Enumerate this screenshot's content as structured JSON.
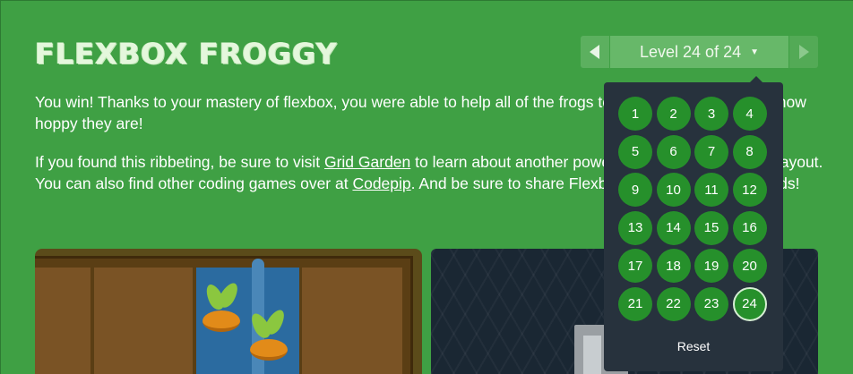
{
  "app": {
    "title": "FLEXBOX FROGGY"
  },
  "instructions": {
    "p1": "You win! Thanks to your mastery of flexbox, you were able to help all of the frogs to their lilypads. Just look how hoppy they are!",
    "p2_before": "If you found this ribbeting, be sure to visit ",
    "p2_link1": "Grid Garden",
    "p2_middle": " to learn about another powerful new feature of CSS layout. You can also find other coding games over at ",
    "p2_link2": "Codepip",
    "p2_after": ". And be sure to share Flexbox Froggy with your friends!"
  },
  "level_nav": {
    "prev_icon": "triangle-left-icon",
    "next_icon": "triangle-right-icon",
    "indicator": "Level 24 of 24",
    "caret_icon": "caret-down-icon"
  },
  "level_dropdown": {
    "levels": [
      "1",
      "2",
      "3",
      "4",
      "5",
      "6",
      "7",
      "8",
      "9",
      "10",
      "11",
      "12",
      "13",
      "14",
      "15",
      "16",
      "17",
      "18",
      "19",
      "20",
      "21",
      "22",
      "23",
      "24"
    ],
    "current": "24",
    "reset_label": "Reset"
  },
  "colors": {
    "background": "#3fa044",
    "dropdown": "#27323d",
    "level_button": "#26902b"
  }
}
